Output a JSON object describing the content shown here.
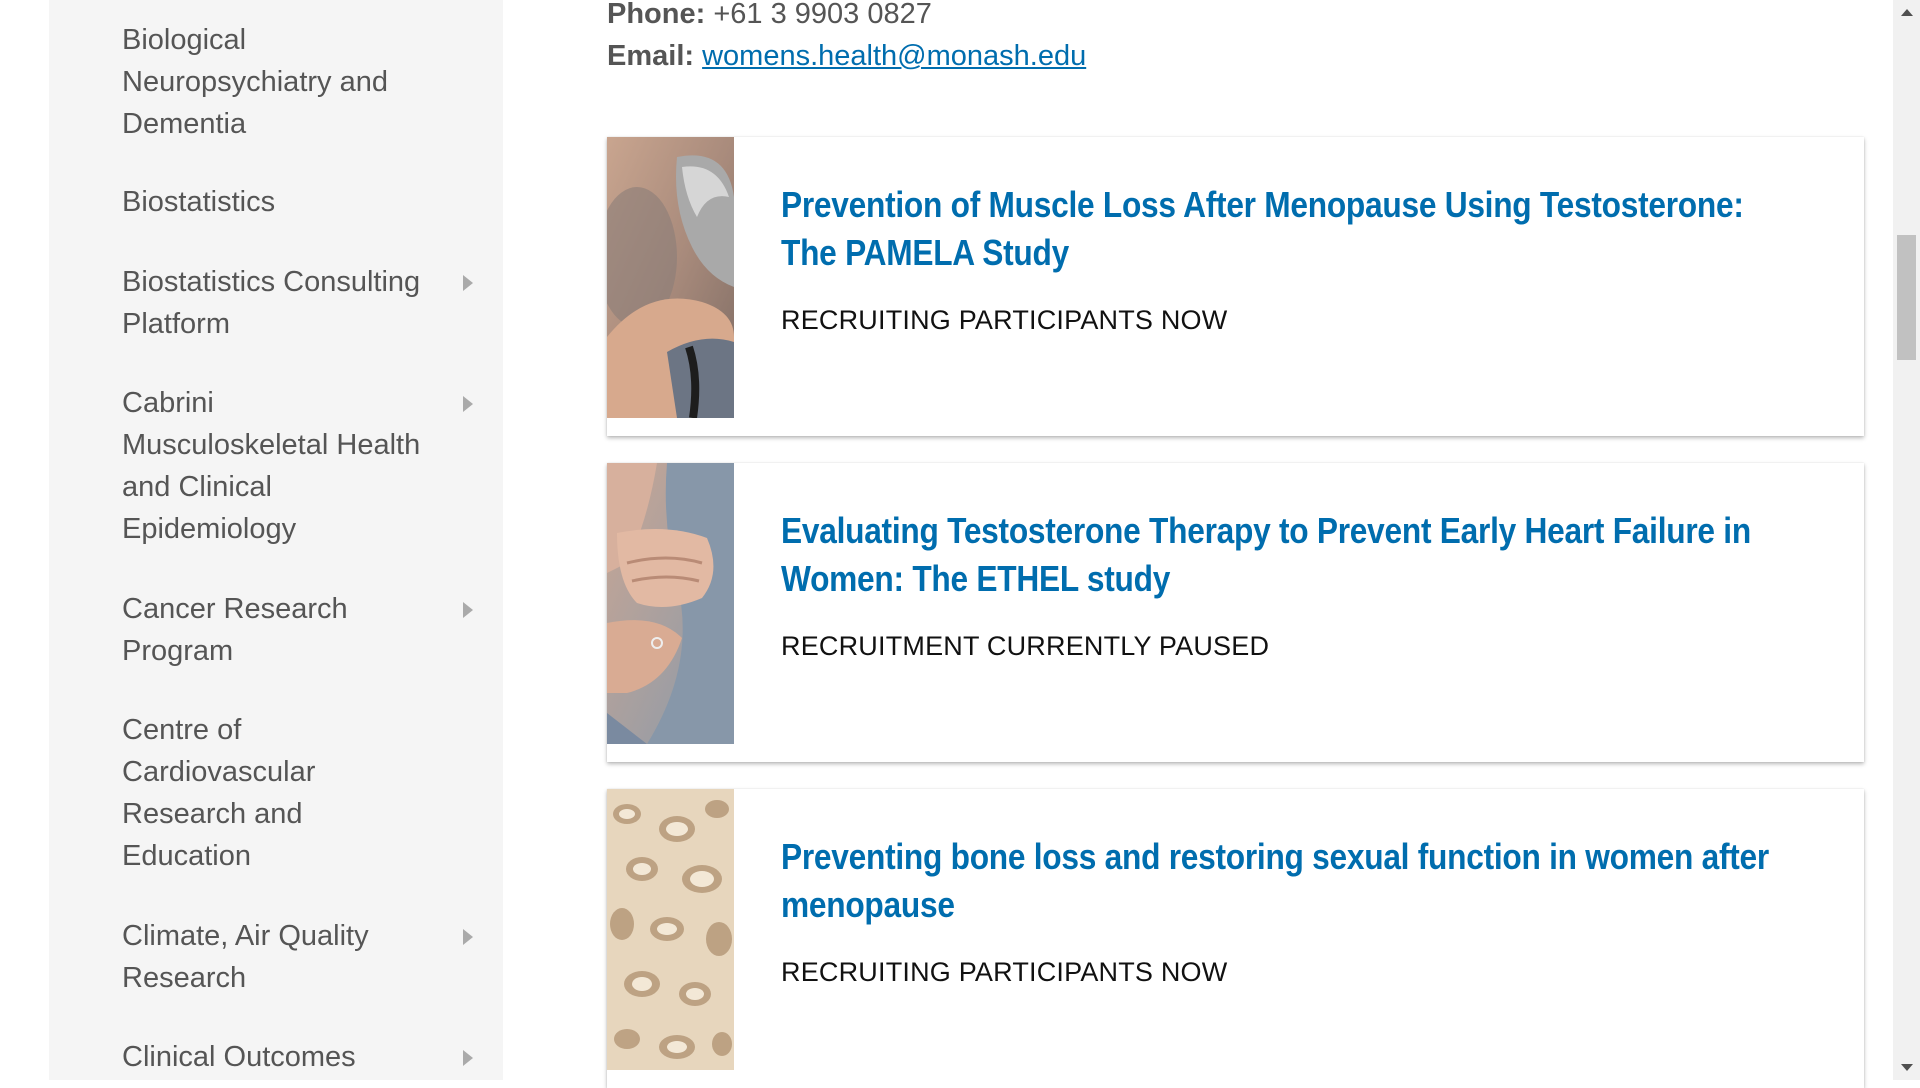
{
  "sidebar": {
    "items": [
      {
        "label": "Biological Neuropsychiatry and Dementia",
        "has_arrow": false
      },
      {
        "label": "Biostatistics",
        "has_arrow": false
      },
      {
        "label": "Biostatistics Consulting Platform",
        "has_arrow": true
      },
      {
        "label": "Cabrini Musculoskeletal Health and Clinical Epidemiology",
        "has_arrow": true
      },
      {
        "label": "Cancer Research Program",
        "has_arrow": true
      },
      {
        "label": "Centre of Cardiovascular Research and Education",
        "has_arrow": false
      },
      {
        "label": "Climate, Air Quality Research",
        "has_arrow": true
      },
      {
        "label": "Clinical Outcomes",
        "has_arrow": true
      }
    ]
  },
  "contact": {
    "phone_label": "Phone:",
    "phone_value": "+61 3 9903 0827",
    "email_label": "Email:",
    "email_value": "womens.health@monash.edu"
  },
  "studies": [
    {
      "title": "Prevention of Muscle Loss After Menopause Using Testosterone: The PAMELA Study",
      "status": "RECRUITING PARTICIPANTS NOW",
      "thumbnail": "woman-shoulder-photo"
    },
    {
      "title": "Evaluating Testosterone Therapy to Prevent Early Heart Failure in Women: The ETHEL study",
      "status": "RECRUITMENT CURRENTLY PAUSED",
      "thumbnail": "hands-on-chest-photo"
    },
    {
      "title": "Preventing bone loss and restoring sexual function in women after menopause",
      "status": "RECRUITING PARTICIPANTS NOW",
      "thumbnail": "bone-structure-photo"
    }
  ],
  "colors": {
    "link": "#006dae",
    "sidebar_bg": "#f5f5f5",
    "nav_text": "#555555"
  }
}
